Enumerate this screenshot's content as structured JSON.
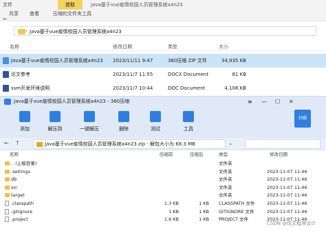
{
  "explorer": {
    "tabs": [
      "文件",
      "共享",
      "查看",
      "提取",
      "压缩的文件夹工具"
    ],
    "title": "Java基于vue疫情校园人员管理系统a4n23",
    "address": "Java基于vue疫情校园人员管理系统a4n23",
    "columns": [
      "名称",
      "修改日期",
      "类型",
      "大小"
    ],
    "files": [
      {
        "name": "Java基于vue疫情校园人员管理系统a4n23",
        "date": "2023/11/11 9:47",
        "type": "360压缩 ZIP 文件",
        "size": "34,935 KB",
        "icon": "zip-icon"
      },
      {
        "name": "论文参考",
        "date": "2023/11/7 11:55",
        "type": "DOCX Document",
        "size": "81 KB",
        "icon": "word-doc-icon"
      },
      {
        "name": "ssm开发环境说明",
        "date": "2023/11/7 10:44",
        "type": "DOC Document",
        "size": "4,108 KB",
        "icon": "word-doc-icon"
      }
    ],
    "colors": {
      "accent_tab": "#f4d35e",
      "selected_row": "#cce4f7"
    }
  },
  "zip": {
    "title": "Java基于vue疫情校园人员管理系统a4n23 - 360压缩",
    "controls": [
      "≡",
      "—",
      "☐",
      "✕"
    ],
    "scan_label": "扫描",
    "toolbar": [
      {
        "label": "添加",
        "icon": "add-icon"
      },
      {
        "label": "解压到",
        "icon": "extract-to-icon"
      },
      {
        "label": "一键解压",
        "icon": "one-click-extract-icon"
      },
      {
        "label": "删除",
        "icon": "delete-icon"
      },
      {
        "label": "测试",
        "icon": "test-icon"
      },
      {
        "label": "工具",
        "icon": "tools-icon"
      }
    ],
    "path": "Java基于vue疫情校园人员管理系统a4n23.zip - 解包大小为 68.3 MB",
    "columns": [
      "名称",
      "压缩前",
      "压缩后",
      "类型",
      "修改日期"
    ],
    "rows": [
      {
        "name": ".. (上级目录)",
        "before": "",
        "after": "",
        "type": "文件夹",
        "date": "",
        "kind": "folder"
      },
      {
        "name": ".settings",
        "before": "",
        "after": "",
        "type": "文件夹",
        "date": "2023-11-07 11:46",
        "kind": "folder"
      },
      {
        "name": "db",
        "before": "",
        "after": "",
        "type": "文件夹",
        "date": "2023-11-07 11:46",
        "kind": "folder"
      },
      {
        "name": "src",
        "before": "",
        "after": "",
        "type": "文件夹",
        "date": "2023-11-07 11:46",
        "kind": "folder"
      },
      {
        "name": "target",
        "before": "",
        "after": "",
        "type": "文件夹",
        "date": "2023-11-07 11:46",
        "kind": "folder"
      },
      {
        "name": ".classpath",
        "before": "1.3 KB",
        "after": "1 KB",
        "type": "CLASSPATH 文件",
        "date": "2023-11-07 11:46",
        "kind": "file"
      },
      {
        "name": ".gitignore",
        "before": "1 KB",
        "after": "1 KB",
        "type": "GITIGNORE 文件",
        "date": "2023-11-07 11:46",
        "kind": "file"
      },
      {
        "name": ".project",
        "before": "1.6 KB",
        "after": "1 KB",
        "type": "PROJECT 文件",
        "date": "2023-11-07 11:46",
        "kind": "file"
      }
    ]
  },
  "watermark": "CSDN @炫文程序设计"
}
